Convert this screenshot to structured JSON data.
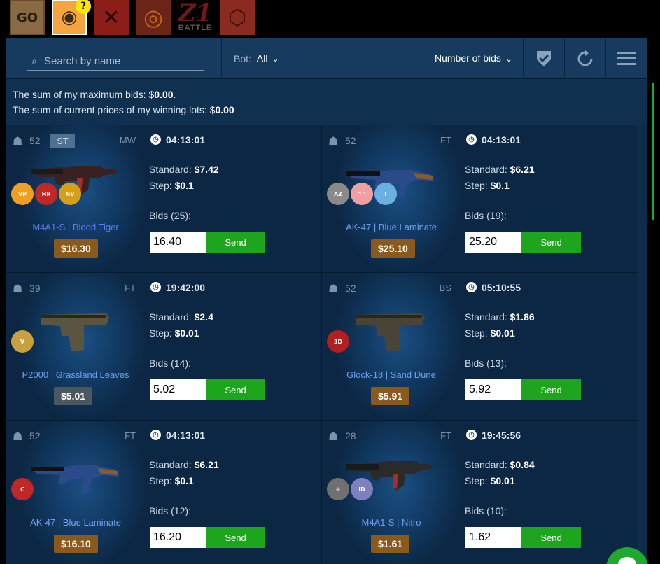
{
  "game_tabs": [
    {
      "id": "csgo",
      "label": "GO"
    },
    {
      "id": "auction",
      "label": ""
    },
    {
      "id": "dota2",
      "label": ""
    },
    {
      "id": "tf2",
      "label": ""
    },
    {
      "id": "h1z1",
      "label": "Z1",
      "sublabel": "BATTLE"
    },
    {
      "id": "rust",
      "label": ""
    }
  ],
  "help_badge": "?",
  "toolbar": {
    "search_placeholder": "Search by name",
    "bot_label": "Bot:",
    "bot_value": "All",
    "sort_label": "Number of bids"
  },
  "summary": {
    "max_bids_label": "The sum of my maximum bids: $",
    "max_bids_value": "0.00",
    "winning_label": "The sum of current prices of my winning lots: $",
    "winning_value": "0.00"
  },
  "send_label": "Send",
  "lots": [
    {
      "bots": "52",
      "badge": "ST",
      "wear": "MW",
      "timer": "04:13:01",
      "standard_label": "Standard:",
      "standard": "$7.42",
      "step_label": "Step:",
      "step": "$0.1",
      "bids_label": "Bids (25):",
      "bid": "16.40",
      "name": "M4A1-S | Blood Tiger",
      "price": "$16.30",
      "price_style": "gold",
      "weapon": "m4",
      "weapon_color": "#3a2020",
      "stickers": [
        {
          "name": "virtus-pro-sticker",
          "color": "#f0a020",
          "text": "VP"
        },
        {
          "name": "hellraisers-sticker",
          "color": "#c02828",
          "text": "HR"
        },
        {
          "name": "navi-sticker",
          "color": "#d4a017",
          "text": "NV"
        }
      ]
    },
    {
      "bots": "52",
      "badge": "",
      "wear": "FT",
      "timer": "04:13:01",
      "standard_label": "Standard:",
      "standard": "$6.21",
      "step_label": "Step:",
      "step": "$0.1",
      "bids_label": "Bids (19):",
      "bid": "25.20",
      "name": "AK-47 | Blue Laminate",
      "price": "$25.10",
      "price_style": "gold",
      "weapon": "ak",
      "weapon_color": "#2a4a8a",
      "stickers": [
        {
          "name": "team-sticker-1",
          "color": "#8a8a8a",
          "text": "AZ"
        },
        {
          "name": "anime-sticker",
          "color": "#f0a0a0",
          "text": "^^"
        },
        {
          "name": "titan-sticker",
          "color": "#6ab0e0",
          "text": "T"
        }
      ]
    },
    {
      "bots": "39",
      "badge": "",
      "wear": "FT",
      "timer": "19:42:00",
      "standard_label": "Standard:",
      "standard": "$2.4",
      "step_label": "Step:",
      "step": "$0.01",
      "bids_label": "Bids (14):",
      "bid": "5.02",
      "name": "P2000 | Grassland Leaves",
      "price": "$5.01",
      "price_style": "gray",
      "weapon": "pistol",
      "weapon_color": "#5a5440",
      "stickers": [
        {
          "name": "team-sticker-2",
          "color": "#c8a040",
          "text": "V"
        }
      ]
    },
    {
      "bots": "52",
      "badge": "",
      "wear": "BS",
      "timer": "05:10:55",
      "standard_label": "Standard:",
      "standard": "$1.86",
      "step_label": "Step:",
      "step": "$0.01",
      "bids_label": "Bids (13):",
      "bid": "5.92",
      "name": "Glock-18 | Sand Dune",
      "price": "$5.91",
      "price_style": "gold",
      "weapon": "pistol",
      "weapon_color": "#4a4438",
      "stickers": [
        {
          "name": "team-sticker-3",
          "color": "#b02020",
          "text": "3D"
        }
      ]
    },
    {
      "bots": "52",
      "badge": "",
      "wear": "FT",
      "timer": "04:13:01",
      "standard_label": "Standard:",
      "standard": "$6.21",
      "step_label": "Step:",
      "step": "$0.1",
      "bids_label": "Bids (12):",
      "bid": "16.20",
      "name": "AK-47 | Blue Laminate",
      "price": "$16.10",
      "price_style": "gold",
      "weapon": "ak",
      "weapon_color": "#2a4a8a",
      "stickers": [
        {
          "name": "team-sticker-4",
          "color": "#c02828",
          "text": "C"
        }
      ]
    },
    {
      "bots": "28",
      "badge": "",
      "wear": "FT",
      "timer": "19:45:56",
      "standard_label": "Standard:",
      "standard": "$0.84",
      "step_label": "Step:",
      "step": "$0.01",
      "bids_label": "Bids (10):",
      "bid": "1.62",
      "name": "M4A1-S | Nitro",
      "price": "$1.61",
      "price_style": "gold",
      "weapon": "m4",
      "weapon_color": "#2a2a2a",
      "stickers": [
        {
          "name": "skull-sticker",
          "color": "#707070",
          "text": "☠"
        },
        {
          "name": "team-sticker-5",
          "color": "#8080c0",
          "text": "ID"
        }
      ]
    }
  ],
  "colors": {
    "accent_green": "#1ea51e",
    "panel_bg": "#0d2d4a",
    "price_gold": "#8a5a1c"
  }
}
